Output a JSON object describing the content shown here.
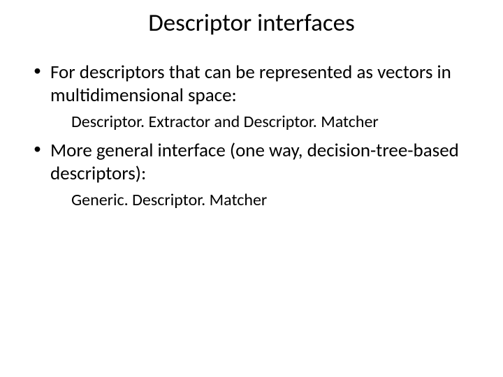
{
  "slide": {
    "title": "Descriptor interfaces",
    "items": [
      {
        "text": "For descriptors that can be represented as vectors in multidimensional space:",
        "sub_parts": {
          "a": "Descriptor. Extractor",
          "sep": " and ",
          "b": "Descriptor. Matcher"
        }
      },
      {
        "text": "More general interface (one way, decision-tree-based descriptors):",
        "sub_parts": {
          "a": "Generic. Descriptor. Matcher"
        }
      }
    ]
  }
}
